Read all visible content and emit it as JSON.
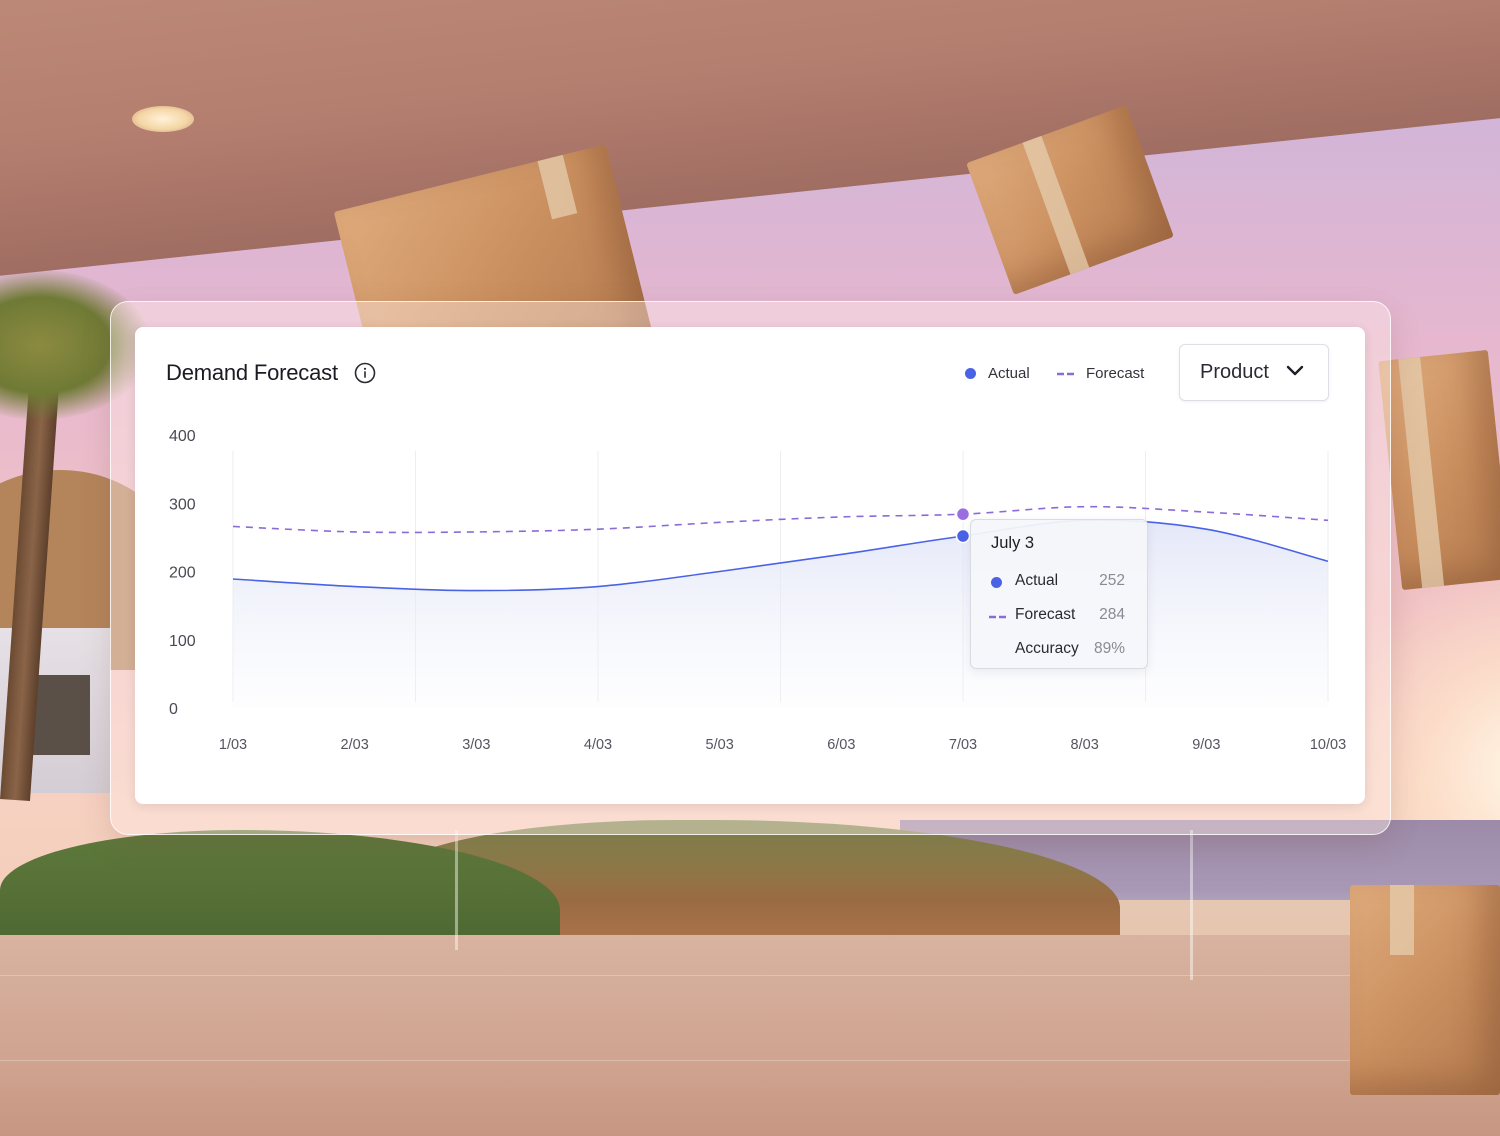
{
  "card": {
    "title": "Demand Forecast",
    "legend": [
      {
        "label": "Actual",
        "color": "#4a63e6",
        "style": "dot"
      },
      {
        "label": "Forecast",
        "color": "#8b6bd6",
        "style": "dashed"
      }
    ],
    "dropdown": {
      "selected": "Product"
    }
  },
  "chart_data": {
    "type": "line",
    "x": [
      "1/03",
      "2/03",
      "3/03",
      "4/03",
      "5/03",
      "6/03",
      "7/03",
      "8/03",
      "9/03",
      "10/03"
    ],
    "ylim": [
      0,
      400
    ],
    "yticks": [
      0,
      100,
      200,
      300,
      400
    ],
    "grid": "vertical",
    "legend_position": "top-right",
    "series": [
      {
        "name": "Actual",
        "color": "#4a63e6",
        "style": "solid-area",
        "values": [
          189,
          178,
          172,
          178,
          200,
          225,
          252,
          275,
          262,
          215
        ]
      },
      {
        "name": "Forecast",
        "color": "#8b6bd6",
        "style": "dashed",
        "values": [
          266,
          258,
          258,
          262,
          272,
          280,
          284,
          295,
          287,
          275
        ]
      }
    ]
  },
  "tooltip": {
    "title": "July 3",
    "rows": [
      {
        "label": "Actual",
        "value": "252",
        "marker": "dot",
        "color": "#4a63e6"
      },
      {
        "label": "Forecast",
        "value": "284",
        "marker": "dashed",
        "color": "#8b6bd6"
      },
      {
        "label": "Accuracy",
        "value": "89%",
        "marker": "none"
      }
    ]
  }
}
